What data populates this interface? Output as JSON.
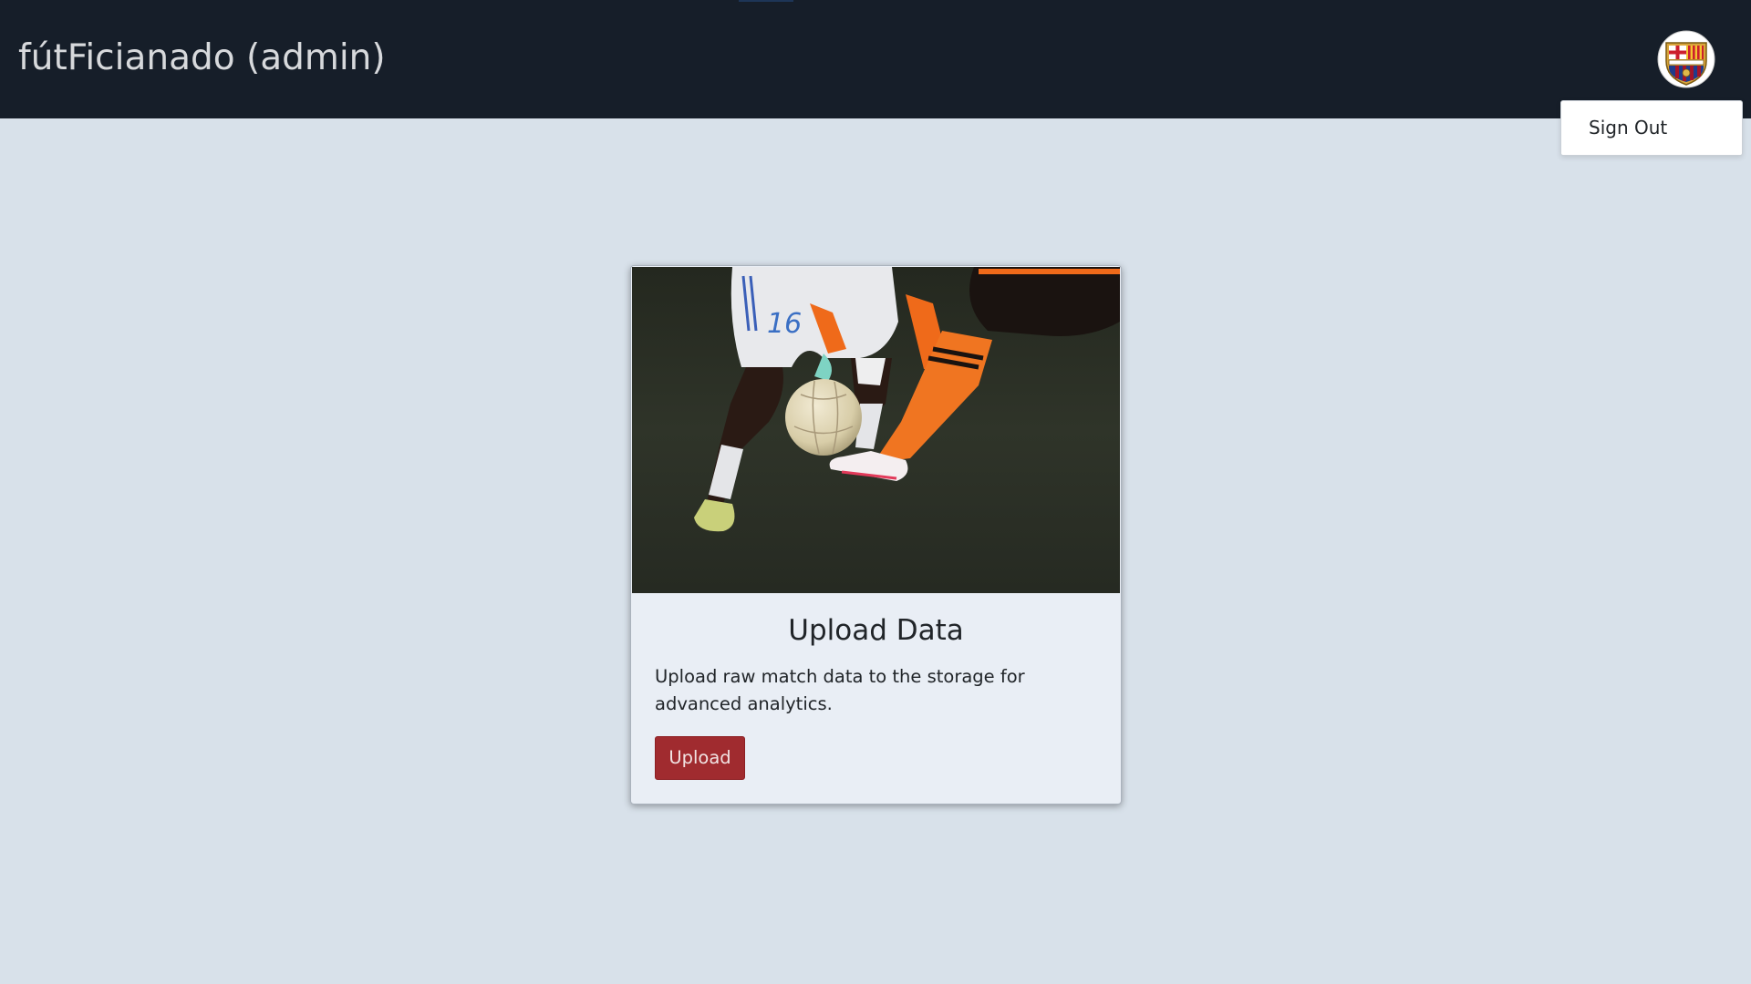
{
  "navbar": {
    "brand_title": "fútFicianado (admin)",
    "avatar_icon": "fc-barcelona-crest-icon"
  },
  "user_menu": {
    "items": [
      {
        "label": "Sign Out"
      }
    ]
  },
  "card": {
    "image_icon": "soccer-players-photo",
    "title": "Upload Data",
    "description": "Upload raw match data to the storage for advanced analytics.",
    "button_label": "Upload"
  },
  "colors": {
    "navbar_bg": "#161e29",
    "page_bg": "#d8e1ea",
    "card_bg": "#e9eef5",
    "button_bg": "#a02b2f"
  }
}
